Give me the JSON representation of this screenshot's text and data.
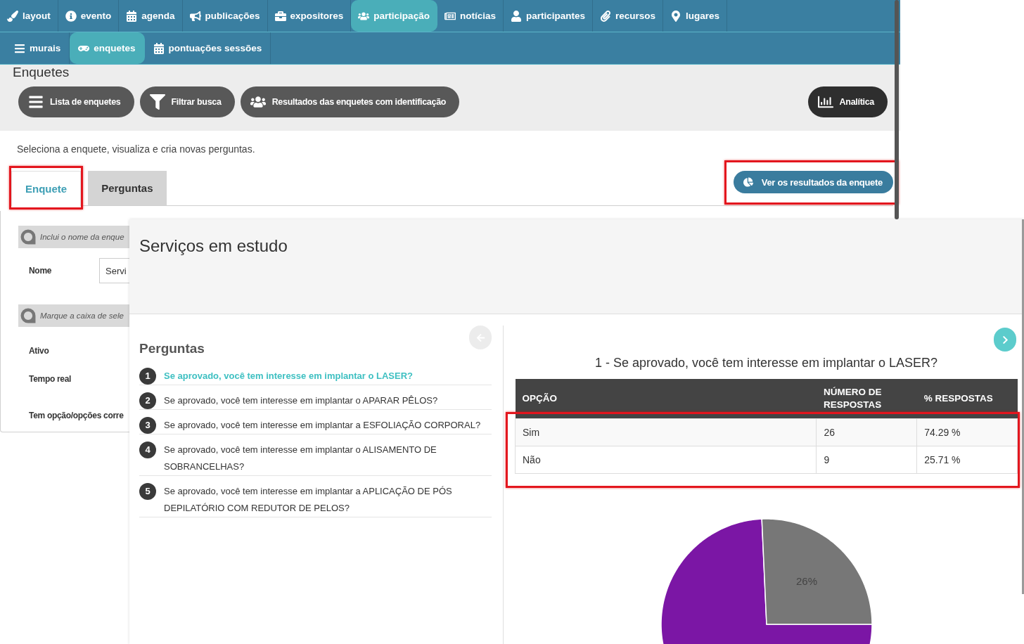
{
  "top_nav": {
    "items": [
      {
        "label": "layout",
        "selected": false
      },
      {
        "label": "evento",
        "selected": false
      },
      {
        "label": "agenda",
        "selected": false
      },
      {
        "label": "publicações",
        "selected": false
      },
      {
        "label": "expositores",
        "selected": false
      },
      {
        "label": "participação",
        "selected": true
      },
      {
        "label": "notícias",
        "selected": false
      },
      {
        "label": "participantes",
        "selected": false
      },
      {
        "label": "recursos",
        "selected": false
      },
      {
        "label": "lugares",
        "selected": false
      }
    ]
  },
  "sub_nav": {
    "items": [
      {
        "label": "murais",
        "selected": false
      },
      {
        "label": "enquetes",
        "selected": true
      },
      {
        "label": "pontuações sessões",
        "selected": false
      }
    ]
  },
  "header": {
    "title": "Enquetes",
    "buttons": [
      {
        "label": "Lista de enquetes"
      },
      {
        "label": "Filtrar busca"
      },
      {
        "label": "Resultados das enquetes com identificação"
      }
    ],
    "analytics_button": {
      "label": "Analítica"
    }
  },
  "description": "Seleciona a enquete, visualiza e cria novas perguntas.",
  "tabs": [
    {
      "label": "Enquete",
      "selected": true,
      "highlighted": true
    },
    {
      "label": "Perguntas",
      "selected": false,
      "highlighted": false
    }
  ],
  "results_button": {
    "label": "Ver os resultados da enquete",
    "highlighted": true
  },
  "form": {
    "sections": [
      {
        "hint": "Inclui o nome da enque",
        "fields": [
          {
            "label": "Nome",
            "value": "Servi"
          }
        ]
      },
      {
        "hint": "Marque a caixa de sele",
        "fields": [
          {
            "label": "Ativo"
          },
          {
            "label": "Tempo real"
          },
          {
            "label": "Tem opção/opções corre"
          }
        ]
      }
    ]
  },
  "modal": {
    "title": "Serviços em estudo",
    "questions_heading": "Perguntas",
    "previous_button": {
      "disabled": true
    },
    "next_button": {
      "disabled": false
    },
    "questions": [
      {
        "number": "1",
        "text": "Se aprovado, você tem interesse em implantar o LASER?",
        "selected": true
      },
      {
        "number": "2",
        "text": "Se aprovado, você tem interesse em implantar o APARAR PÊLOS?",
        "selected": false
      },
      {
        "number": "3",
        "text": "Se aprovado, você tem interesse em implantar a ESFOLIAÇÃO CORPORAL?",
        "selected": false
      },
      {
        "number": "4",
        "text": "Se aprovado, você tem interesse em implantar o ALISAMENTO DE SOBRANCELHAS?",
        "selected": false
      },
      {
        "number": "5",
        "text": "Se aprovado, você tem interesse em implantar a APLICAÇÃO DE PÓS DEPILATÓRIO COM REDUTOR DE PELOS?",
        "selected": false
      }
    ],
    "result": {
      "title": "1 - Se aprovado, você tem interesse em implantar o LASER?",
      "columns": [
        "OPÇÃO",
        "NÚMERO DE RESPOSTAS",
        "% RESPOSTAS"
      ],
      "rows": [
        [
          "Sim",
          "26",
          "74.29 %"
        ],
        [
          "Não",
          "9",
          "25.71 %"
        ]
      ],
      "rows_highlighted": true,
      "pie": {
        "slices": [
          {
            "color": "#7b16a5"
          },
          {
            "color": "#777777",
            "label": "26%"
          }
        ]
      }
    }
  }
}
